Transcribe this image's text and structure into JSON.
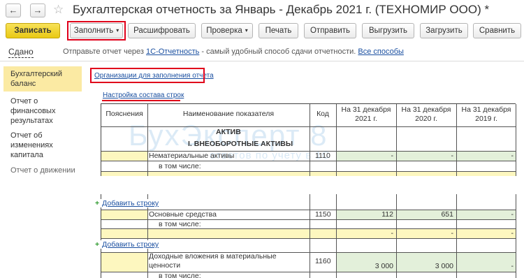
{
  "window": {
    "title": "Бухгалтерская отчетность за Январь - Декабрь 2021 г. (ТЕХНОМИР ООО) *",
    "back_glyph": "←",
    "forward_glyph": "→",
    "favorite_glyph": "☆"
  },
  "toolbar": {
    "save": "Записать",
    "fill": "Заполнить",
    "decode": "Расшифровать",
    "check": "Проверка",
    "print": "Печать",
    "send": "Отправить",
    "export": "Выгрузить",
    "import": "Загрузить",
    "compare": "Сравнить",
    "dropdown_glyph": "▾"
  },
  "notice": {
    "tab": "Сдано",
    "text_before": "Отправьте отчет через ",
    "link": "1С-Отчетность",
    "text_after": " - самый удобный способ сдачи отчетности. ",
    "all_methods": "Все способы"
  },
  "sections": [
    "Бухгалтерский баланс",
    "Отчет о финансовых результатах",
    "Отчет об изменениях капитала",
    "Отчет о движении"
  ],
  "links": {
    "orgs_fill": "Организации для заполнения отчета",
    "row_setup": "Настройка состава строк",
    "add_row": "Добавить строку",
    "plus_glyph": "+"
  },
  "watermark": {
    "brand": "БухЭксперт 8",
    "sub": "ответов по учету в 1С"
  },
  "table": {
    "headers": {
      "notes": "Пояснения",
      "name": "Наименование показателя",
      "code": "Код",
      "y2021": "На 31 декабря 2021 г.",
      "y2020": "На 31 декабря 2020 г.",
      "y2019": "На 31 декабря 2019 г."
    },
    "section_aktiv": "АКТИВ",
    "section_noncurrent": "I. ВНЕОБОРОТНЫЕ АКТИВЫ",
    "including": "в том числе:",
    "rows": [
      {
        "name": "Нематериальные активы",
        "code": "1110",
        "y2021": "-",
        "y2020": "-",
        "y2019": "-"
      },
      {
        "name": "Основные средства",
        "code": "1150",
        "y2021": "112",
        "y2020": "651",
        "y2019": "-"
      },
      {
        "name": "Доходные вложения в материальные ценности",
        "code": "1160",
        "y2021": "3 000",
        "y2020": "3 000",
        "y2019": "-"
      }
    ],
    "sub_dash": "-"
  }
}
